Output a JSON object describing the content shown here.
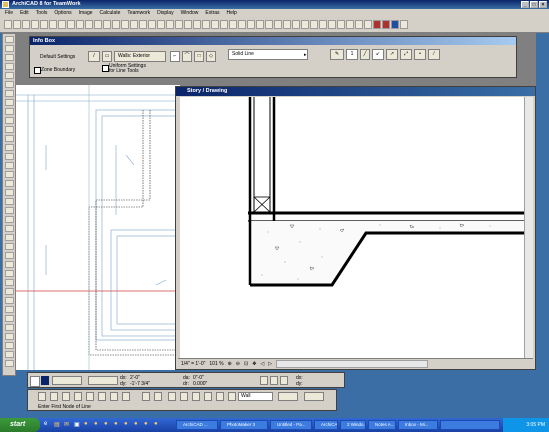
{
  "window": {
    "title": "ArchiCAD 8 for TeamWork"
  },
  "menu": [
    "File",
    "Edit",
    "Tools",
    "Options",
    "Image",
    "Calculate",
    "Teamwork",
    "Display",
    "Window",
    "Extras",
    "Help"
  ],
  "info_box": {
    "title": "Info Box",
    "default_settings": "Default Settings",
    "wall_type": "Walls: Exterior",
    "line_type": "Solid Line",
    "pen_label": "1",
    "zone_boundary": "Zone Boundary",
    "uniform_settings": "Uniform Settings for Line Tools"
  },
  "drawing_window": {
    "title": "Story / Drawing",
    "scale": "1/4\"  =  1'-0\"",
    "zoom": "101 %"
  },
  "coord_box": {
    "dx_label": "dx:",
    "dx": "2'-0\"",
    "dy_label": "dy:",
    "dy": "-1'-7 3/4\"",
    "da_label": "da:",
    "da": "0\"-0\"",
    "dr_label": "dr:",
    "dr": "0.000\""
  },
  "control_box": {
    "prompt": "Enter First Node of Line",
    "layer": "Wall"
  },
  "taskbar": {
    "start": "start",
    "tasks": [
      "ArchiCAD ...",
      "PhotoMaker 3",
      "Untitled - Pa...",
      "ArchiCAD...",
      "2 Windo...",
      "Notes A...",
      "Inbox - Mi...",
      ""
    ],
    "clock": "3:05 PM"
  },
  "colors": {
    "titlebar": "#0a246a",
    "desktop": "#3a6ea5",
    "panel": "#d4d0c8"
  }
}
